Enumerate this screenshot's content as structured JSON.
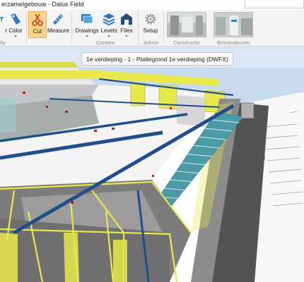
{
  "window": {
    "title": "erzamelgebouw - Dalux Field"
  },
  "ribbon": {
    "buttons": {
      "filter": {
        "label": "r"
      },
      "color": {
        "label": "Color"
      },
      "cut": {
        "label": "Cut"
      },
      "measure": {
        "label": "Measure"
      },
      "drawings": {
        "label": "Drawings"
      },
      "levels": {
        "label": "Levels"
      },
      "files": {
        "label": "Files"
      },
      "setup": {
        "label": "Setup"
      }
    },
    "groups": {
      "visibility": "ity",
      "content": "Content",
      "admin": "Admin"
    },
    "views": [
      {
        "label": "Constructie"
      },
      {
        "label": "Binnendeuren"
      }
    ]
  },
  "viewport": {
    "tooltip": "1e verdieping - 1 - Plattegrond 1e verdieping (DWFX)"
  },
  "colors": {
    "ribbon_bg": "#f3f3f3",
    "active_button": "#fbd58a",
    "structure_yellow": "#e8e84a",
    "beam_blue": "#1f4e8c",
    "stair_teal": "#4a9aa8",
    "sky": "#c8daf0"
  }
}
